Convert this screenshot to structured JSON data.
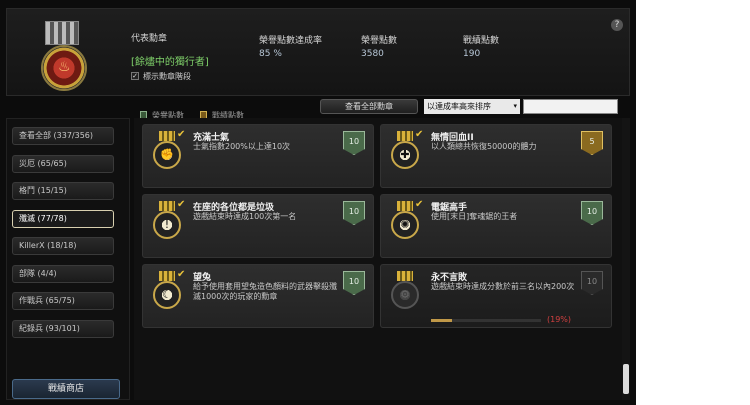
{
  "header": {
    "help_label": "?",
    "rep_medal_label": "代表勳章",
    "rep_medal_name": "[餘燼中的獨行者]",
    "show_stage_label": "標示勳章階段",
    "show_stage_checked": "✓",
    "stats": [
      {
        "label": "榮譽點數達成率",
        "value": "85 %"
      },
      {
        "label": "榮譽點數",
        "value": "3580"
      },
      {
        "label": "戰績點數",
        "value": "190"
      }
    ]
  },
  "toolbar": {
    "legend_honor": "榮譽點數",
    "legend_record": "戰績點數",
    "view_all": "查看全部勳章",
    "sort_selected": "以達成率高來排序",
    "search_value": ""
  },
  "sidebar": {
    "categories": [
      {
        "label": "查看全部 (337/356)"
      },
      {
        "label": "災厄 (65/65)"
      },
      {
        "label": "格鬥 (15/15)"
      },
      {
        "label": "殲滅 (77/78)"
      },
      {
        "label": "KillerX (18/18)"
      },
      {
        "label": "部隊 (4/4)"
      },
      {
        "label": "作戰兵 (65/75)"
      },
      {
        "label": "紀錄兵 (93/101)"
      }
    ],
    "active_index": 3,
    "shop_label": "戰績商店"
  },
  "medals": [
    {
      "title": "充滿士氣",
      "desc": "士氣指數200%以上達10次",
      "points": "10",
      "badge": "green",
      "icon": "fist-icon",
      "glyph": "✊",
      "achieved": true
    },
    {
      "title": "無情回血II",
      "desc": "以人類總共恢復50000的體力",
      "points": "5",
      "badge": "gold",
      "icon": "heart-icon",
      "glyph": "✚",
      "achieved": true
    },
    {
      "title": "在座的各位都是垃圾",
      "desc": "遊戲結束時達成100次第一名",
      "points": "10",
      "badge": "green",
      "icon": "exclamation-icon",
      "glyph": "!",
      "achieved": true
    },
    {
      "title": "電鋸高手",
      "desc": "使用[末日]奪魂鋸的王者",
      "points": "10",
      "badge": "green",
      "icon": "saw-icon",
      "glyph": "✺",
      "achieved": true
    },
    {
      "title": "望兔",
      "desc": "給予使用套用望兔造色顏料的武器擊殺殲滅1000次的玩家的勳章",
      "points": "10",
      "badge": "green",
      "icon": "rabbit-icon",
      "glyph": "☾",
      "achieved": true
    },
    {
      "title": "永不言敗",
      "desc": "遊戲結束時達成分數於前三名以內200次",
      "points": "10",
      "badge": "grey",
      "icon": "gear-icon",
      "glyph": "⚙",
      "achieved": false,
      "progress": 0.19,
      "progress_text": "(19%)"
    }
  ]
}
